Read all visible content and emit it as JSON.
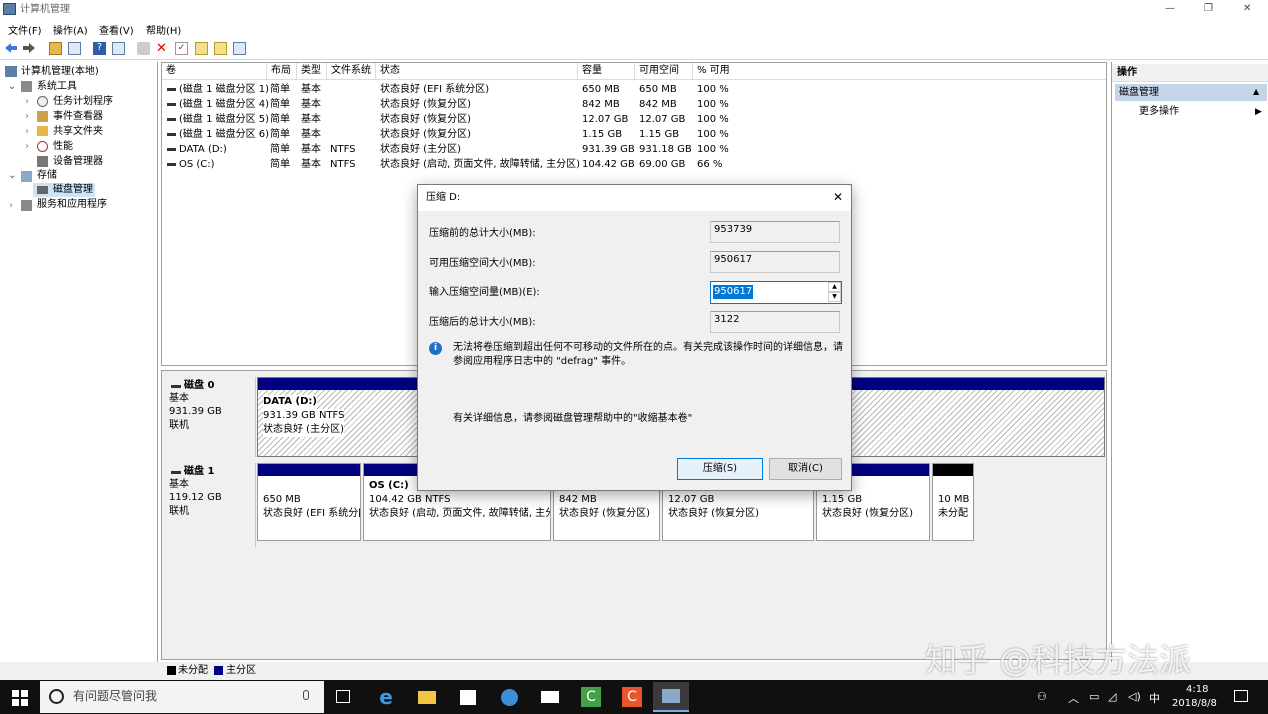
{
  "window": {
    "title": "计算机管理",
    "controls": {
      "minimize": "—",
      "maximize": "❐",
      "close": "✕"
    }
  },
  "menu": [
    "文件(F)",
    "操作(A)",
    "查看(V)",
    "帮助(H)"
  ],
  "tree": {
    "root": "计算机管理(本地)",
    "system_tools": "系统工具",
    "task_scheduler": "任务计划程序",
    "event_viewer": "事件查看器",
    "shared_folders": "共享文件夹",
    "performance": "性能",
    "device_manager": "设备管理器",
    "storage": "存储",
    "disk_management": "磁盘管理",
    "services": "服务和应用程序"
  },
  "volumes": {
    "headers": [
      "卷",
      "布局",
      "类型",
      "文件系统",
      "状态",
      "容量",
      "可用空间",
      "% 可用"
    ],
    "rows": [
      [
        "(磁盘 1 磁盘分区 1)",
        "简单",
        "基本",
        "",
        "状态良好 (EFI 系统分区)",
        "650 MB",
        "650 MB",
        "100 %"
      ],
      [
        "(磁盘 1 磁盘分区 4)",
        "简单",
        "基本",
        "",
        "状态良好 (恢复分区)",
        "842 MB",
        "842 MB",
        "100 %"
      ],
      [
        "(磁盘 1 磁盘分区 5)",
        "简单",
        "基本",
        "",
        "状态良好 (恢复分区)",
        "12.07 GB",
        "12.07 GB",
        "100 %"
      ],
      [
        "(磁盘 1 磁盘分区 6)",
        "简单",
        "基本",
        "",
        "状态良好 (恢复分区)",
        "1.15 GB",
        "1.15 GB",
        "100 %"
      ],
      [
        "DATA (D:)",
        "简单",
        "基本",
        "NTFS",
        "状态良好 (主分区)",
        "931.39 GB",
        "931.18 GB",
        "100 %"
      ],
      [
        "OS (C:)",
        "简单",
        "基本",
        "NTFS",
        "状态良好 (启动, 页面文件, 故障转储, 主分区)",
        "104.42 GB",
        "69.00 GB",
        "66 %"
      ]
    ]
  },
  "disk0": {
    "name": "磁盘 0",
    "type": "基本",
    "size": "931.39 GB",
    "status": "联机",
    "partition": {
      "name": "DATA  (D:)",
      "size": "931.39 GB NTFS",
      "status": "状态良好 (主分区)"
    }
  },
  "disk1": {
    "name": "磁盘 1",
    "type": "基本",
    "size": "119.12 GB",
    "status": "联机",
    "partitions": [
      {
        "title": "",
        "size": "650 MB",
        "status": "状态良好 (EFI 系统分[",
        "kind": "primary"
      },
      {
        "title": "OS  (C:)",
        "size": "104.42 GB NTFS",
        "status": "状态良好 (启动, 页面文件, 故障转储, 主分",
        "kind": "primary"
      },
      {
        "title": "",
        "size": "842 MB",
        "status": "状态良好 (恢复分区)",
        "kind": "primary"
      },
      {
        "title": "",
        "size": "12.07 GB",
        "status": "状态良好 (恢复分区)",
        "kind": "primary"
      },
      {
        "title": "",
        "size": "1.15 GB",
        "status": "状态良好 (恢复分区)",
        "kind": "primary"
      },
      {
        "title": "",
        "size": "10 MB",
        "status": "未分配",
        "kind": "unallocated"
      }
    ]
  },
  "legend": {
    "unallocated": "未分配",
    "primary": "主分区"
  },
  "actions": {
    "title": "操作",
    "section": "磁盘管理",
    "more": "更多操作"
  },
  "dialog": {
    "title": "压缩 D:",
    "total_before_label": "压缩前的总计大小(MB):",
    "total_before_value": "953739",
    "available_label": "可用压缩空间大小(MB):",
    "available_value": "950617",
    "input_label": "输入压缩空间量(MB)(E):",
    "input_value": "950617",
    "total_after_label": "压缩后的总计大小(MB):",
    "total_after_value": "3122",
    "info_line1": "无法将卷压缩到超出任何不可移动的文件所在的点。有关完成该操作时间的详细信息，请",
    "info_line2": "参阅应用程序日志中的 \"defrag\" 事件。",
    "help_text": "有关详细信息，请参阅磁盘管理帮助中的\"收缩基本卷\"",
    "shrink_button": "压缩(S)",
    "cancel_button": "取消(C)"
  },
  "watermark": "知乎 @科技方法派",
  "taskbar": {
    "search_placeholder": "有问题尽管问我",
    "time": "4:18",
    "date": "2018/8/8",
    "ime": "中"
  },
  "colors": {
    "primary_partition": "#000080",
    "unallocated": "#000000",
    "selection": "#0078d7",
    "taskbar": "#101010"
  }
}
